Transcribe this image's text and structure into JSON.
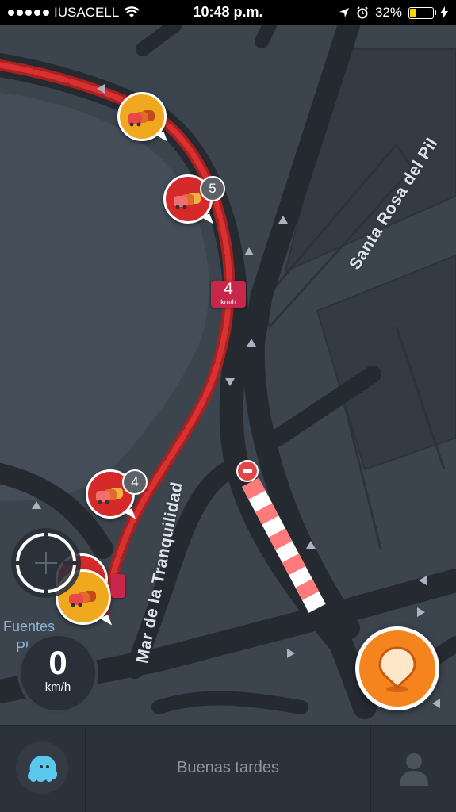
{
  "status_bar": {
    "carrier": "IUSACELL",
    "time": "10:48 p.m.",
    "battery": "32%",
    "battery_level": 0.32
  },
  "map": {
    "street_labels": [
      "Santa Rosa del Pil",
      "Mar de la Tranquilidad"
    ],
    "place_label_lines": [
      "Fuentes",
      "Plaza"
    ],
    "traffic_reports": [
      {
        "color": "yellow",
        "count": ""
      },
      {
        "color": "red",
        "count": "5"
      },
      {
        "color": "red",
        "count": "4"
      },
      {
        "color": "yellow",
        "count": ""
      }
    ],
    "speed_marker": {
      "value": "4",
      "unit": "km/h"
    }
  },
  "speedometer": {
    "value": "0",
    "unit": "km/h"
  },
  "bottom_bar": {
    "greeting": "Buenas tardes"
  },
  "colors": {
    "traffic_jam": "#d62a2a",
    "report_button": "#f5841f",
    "road": "#252a31",
    "closure": "#ff7b7b"
  },
  "icons": {
    "menu": "waze-ghost-icon",
    "profile": "person-icon",
    "report": "report-pin-icon",
    "recenter": "crosshair-icon"
  }
}
